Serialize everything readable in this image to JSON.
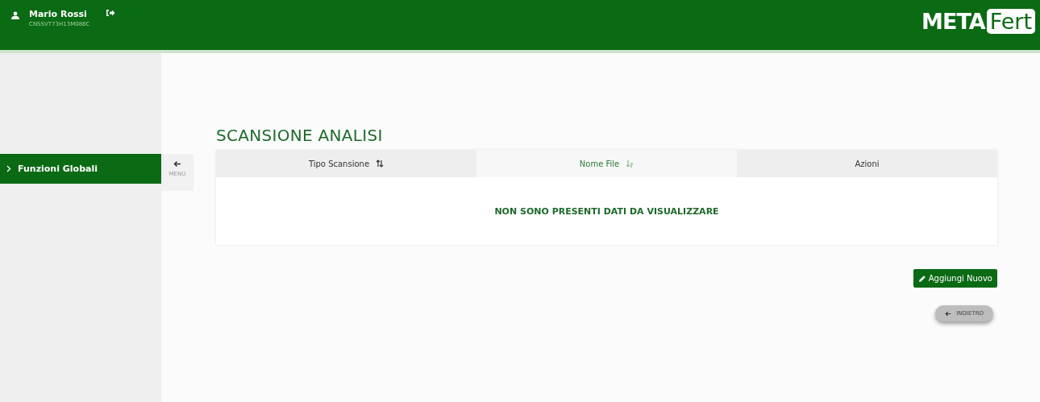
{
  "header": {
    "user_name": "Mario Rossi",
    "user_code": "CNSSVT73H13M088C",
    "logo_left": "META",
    "logo_right": "Fert"
  },
  "sidebar": {
    "items": [
      {
        "label": "Funzioni Globali",
        "selected": true
      }
    ],
    "toggle_label": "MENU"
  },
  "page": {
    "title": "SCANSIONE ANALISI"
  },
  "table": {
    "columns": [
      {
        "label": "Tipo Scansione",
        "kind": "sortable",
        "selected": false
      },
      {
        "label": "Nome File",
        "kind": "sorted",
        "selected": true
      },
      {
        "label": "Azioni",
        "kind": "plain",
        "selected": false
      }
    ],
    "empty_message": "NON SONO PRESENTI DATI DA VISUALIZZARE"
  },
  "buttons": {
    "add": "Aggiungi Nuovo",
    "back": "INDIETRO"
  }
}
